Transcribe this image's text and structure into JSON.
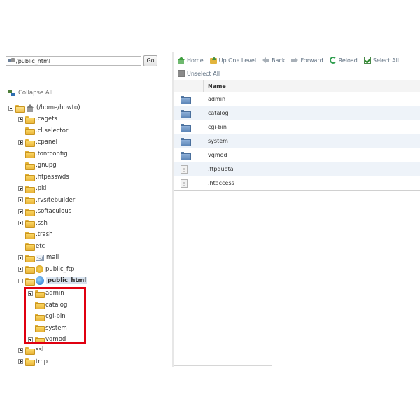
{
  "path_bar": {
    "path_value": "/public_html",
    "go_label": "Go"
  },
  "tree": {
    "collapse_label": "Collapse All",
    "root_label": "(/home/howto)",
    "items": [
      {
        "label": ".cagefs",
        "expander": "plus",
        "icon": "folder-icon"
      },
      {
        "label": ".cl.selector",
        "expander": "none",
        "icon": "folder-icon"
      },
      {
        "label": ".cpanel",
        "expander": "plus",
        "icon": "folder-icon"
      },
      {
        "label": ".fontconfig",
        "expander": "none",
        "icon": "folder-icon"
      },
      {
        "label": ".gnupg",
        "expander": "none",
        "icon": "folder-icon"
      },
      {
        "label": ".htpasswds",
        "expander": "none",
        "icon": "folder-icon"
      },
      {
        "label": ".pki",
        "expander": "plus",
        "icon": "folder-icon"
      },
      {
        "label": ".rvsitebuilder",
        "expander": "plus",
        "icon": "folder-icon"
      },
      {
        "label": ".softaculous",
        "expander": "plus",
        "icon": "folder-icon"
      },
      {
        "label": ".ssh",
        "expander": "plus",
        "icon": "folder-icon"
      },
      {
        "label": ".trash",
        "expander": "none",
        "icon": "folder-icon"
      },
      {
        "label": "etc",
        "expander": "none",
        "icon": "folder-icon"
      },
      {
        "label": "mail",
        "expander": "plus",
        "icon": "mail-icon"
      },
      {
        "label": "public_ftp",
        "expander": "plus",
        "icon": "ftp-icon"
      },
      {
        "label": "public_html",
        "expander": "minus",
        "icon": "globe-icon",
        "selected": true
      },
      {
        "label": "ssl",
        "expander": "plus",
        "icon": "folder-icon"
      },
      {
        "label": "tmp",
        "expander": "plus",
        "icon": "folder-icon"
      }
    ],
    "public_html_children": [
      {
        "label": "admin",
        "expander": "plus"
      },
      {
        "label": "catalog",
        "expander": "none"
      },
      {
        "label": "cgi-bin",
        "expander": "none"
      },
      {
        "label": "system",
        "expander": "none"
      },
      {
        "label": "vqmod",
        "expander": "plus"
      }
    ],
    "highlight_color": "#e00010"
  },
  "toolbar": {
    "home": "Home",
    "up_one_level": "Up One Level",
    "back": "Back",
    "forward": "Forward",
    "reload": "Reload",
    "select_all": "Select All",
    "unselect_all": "Unselect All"
  },
  "table": {
    "column_name": "Name",
    "rows": [
      {
        "name": "admin",
        "type": "folder"
      },
      {
        "name": "catalog",
        "type": "folder"
      },
      {
        "name": "cgi-bin",
        "type": "folder"
      },
      {
        "name": "system",
        "type": "folder"
      },
      {
        "name": "vqmod",
        "type": "folder"
      },
      {
        "name": ".ftpquota",
        "type": "file"
      },
      {
        "name": ".htaccess",
        "type": "file"
      }
    ]
  }
}
